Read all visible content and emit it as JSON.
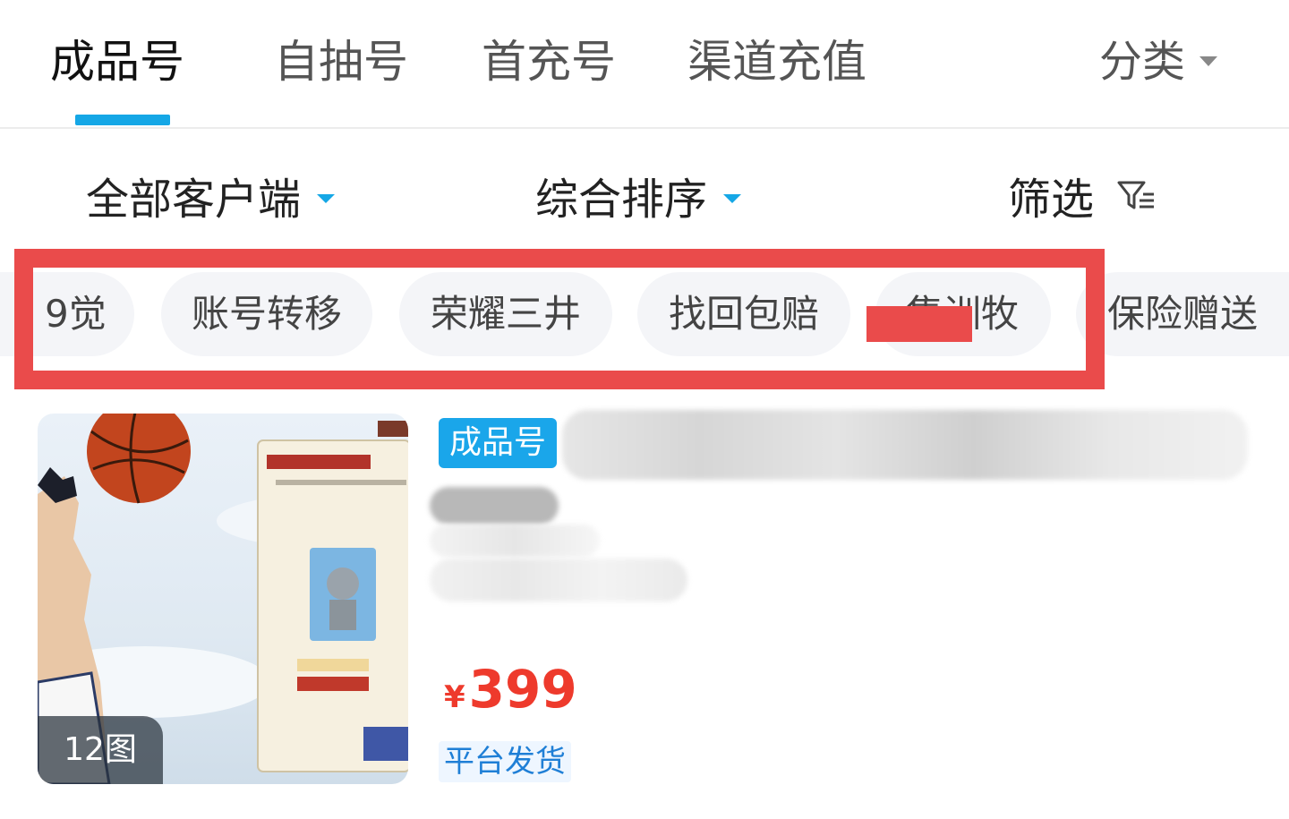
{
  "tabs": [
    {
      "label": "成品号",
      "active": true
    },
    {
      "label": "自抽号",
      "active": false
    },
    {
      "label": "首充号",
      "active": false
    },
    {
      "label": "渠道充值",
      "active": false
    }
  ],
  "category": {
    "label": "分类"
  },
  "filters": {
    "client": "全部客户端",
    "sort": "综合排序",
    "screen": "筛选"
  },
  "chips": [
    "9觉",
    "账号转移",
    "荣耀三井",
    "找回包赔",
    "集训牧",
    "保险赠送"
  ],
  "listing": {
    "image_count": "12图",
    "badge": "成品号",
    "currency": "¥",
    "price": "399",
    "shipping": "平台发货"
  },
  "colors": {
    "accent": "#15a7e6",
    "highlight": "#ea4b4b",
    "price": "#ee3a2c"
  },
  "icons": {
    "filter": "filter-funnel-icon",
    "caret": "chevron-down-icon"
  }
}
